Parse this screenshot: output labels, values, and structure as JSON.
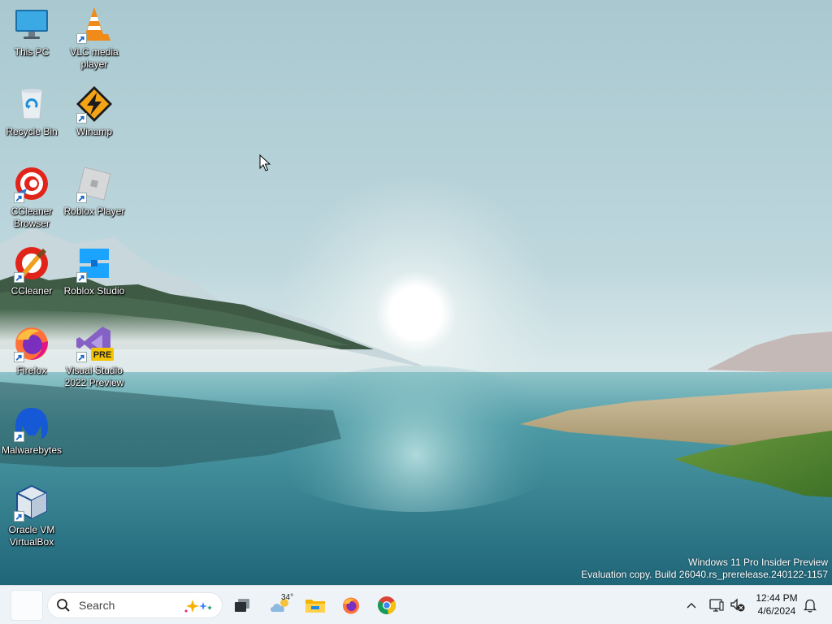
{
  "desktop": {
    "icons": [
      {
        "label": "This PC",
        "icon": "monitor-icon",
        "shortcut": false
      },
      {
        "label": "VLC media player",
        "icon": "vlc-cone-icon",
        "shortcut": true
      },
      {
        "label": "Recycle Bin",
        "icon": "recycle-bin-icon",
        "shortcut": false
      },
      {
        "label": "Winamp",
        "icon": "winamp-icon",
        "shortcut": true
      },
      {
        "label": "CCleaner Browser",
        "icon": "ccleaner-browser-icon",
        "shortcut": true
      },
      {
        "label": "Roblox Player",
        "icon": "roblox-player-icon",
        "shortcut": true
      },
      {
        "label": "CCleaner",
        "icon": "ccleaner-icon",
        "shortcut": true
      },
      {
        "label": "Roblox Studio",
        "icon": "roblox-studio-icon",
        "shortcut": true
      },
      {
        "label": "Firefox",
        "icon": "firefox-icon",
        "shortcut": true
      },
      {
        "label": "Visual Studio 2022 Preview",
        "icon": "visual-studio-preview-icon",
        "shortcut": true,
        "badge": "PRE"
      },
      {
        "label": "Malwarebytes",
        "icon": "malwarebytes-icon",
        "shortcut": true
      },
      {
        "label": "Oracle VM VirtualBox",
        "icon": "virtualbox-icon",
        "shortcut": true
      }
    ]
  },
  "watermark": {
    "line1": "Windows 11 Pro Insider Preview",
    "line2": "Evaluation copy. Build 26040.rs_prerelease.240122-1157"
  },
  "taskbar": {
    "search": {
      "placeholder": "Search"
    },
    "weather": {
      "temperature": "34°",
      "icon": "partly-cloudy-icon"
    },
    "pinned": [
      "task-view-icon",
      "weather-widget-icon",
      "file-explorer-icon",
      "firefox-icon",
      "chrome-icon"
    ],
    "tray": {
      "icons": [
        "chevron-up-icon",
        "network-icon",
        "volume-muted-icon",
        "notification-bell-icon"
      ],
      "time": "12:44 PM",
      "date": "4/6/2024"
    }
  },
  "colors": {
    "taskbar_bg": "#eef3f7",
    "sky_top": "#b9d3da",
    "water": "#2f7f8f"
  }
}
